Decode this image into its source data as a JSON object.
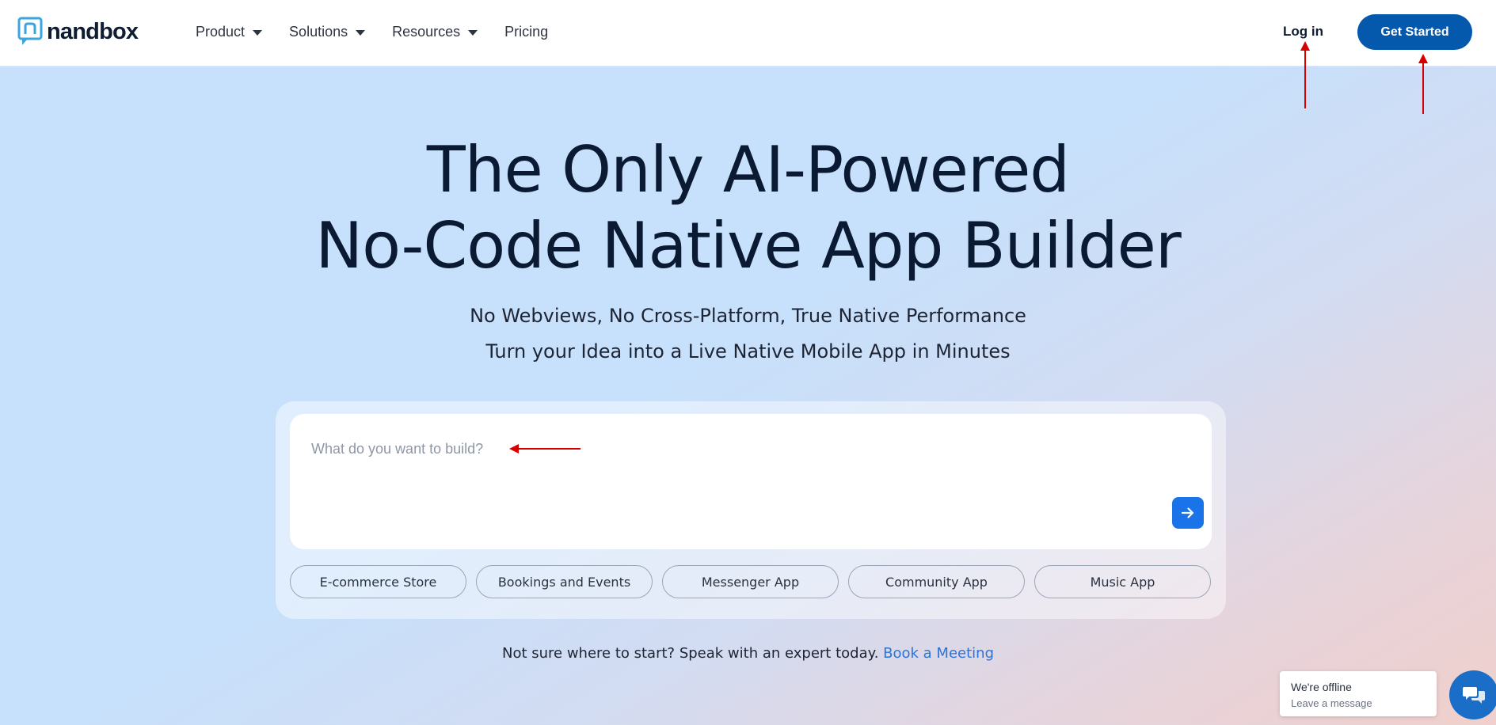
{
  "header": {
    "logo_text": "nandbox",
    "nav": [
      {
        "label": "Product",
        "has_dropdown": true
      },
      {
        "label": "Solutions",
        "has_dropdown": true
      },
      {
        "label": "Resources",
        "has_dropdown": true
      },
      {
        "label": "Pricing",
        "has_dropdown": false
      }
    ],
    "login_label": "Log in",
    "cta_label": "Get Started"
  },
  "hero": {
    "title_line1": "The Only AI-Powered",
    "title_line2": "No-Code Native App Builder",
    "subtitle_line1": "No Webviews, No Cross-Platform, True Native Performance",
    "subtitle_line2": "Turn your Idea into a Live Native Mobile App in Minutes"
  },
  "prompt": {
    "placeholder": "What do you want to build?",
    "value": "",
    "send_icon": "arrow-right-icon"
  },
  "chips": [
    {
      "label": "E-commerce Store"
    },
    {
      "label": "Bookings and Events"
    },
    {
      "label": "Messenger App"
    },
    {
      "label": "Community App"
    },
    {
      "label": "Music App"
    }
  ],
  "helper": {
    "text": "Not sure where to start? Speak with an expert today.",
    "link_label": "Book a Meeting"
  },
  "chat": {
    "title": "We're offline",
    "subtitle": "Leave a message",
    "launcher_icon": "chat-bubbles-icon"
  },
  "colors": {
    "brand_blue": "#0459ad",
    "accent_blue": "#1a73e8",
    "link_blue": "#2b74d8",
    "annotation_red": "#d60000",
    "logo_blue": "#3aa5df"
  }
}
